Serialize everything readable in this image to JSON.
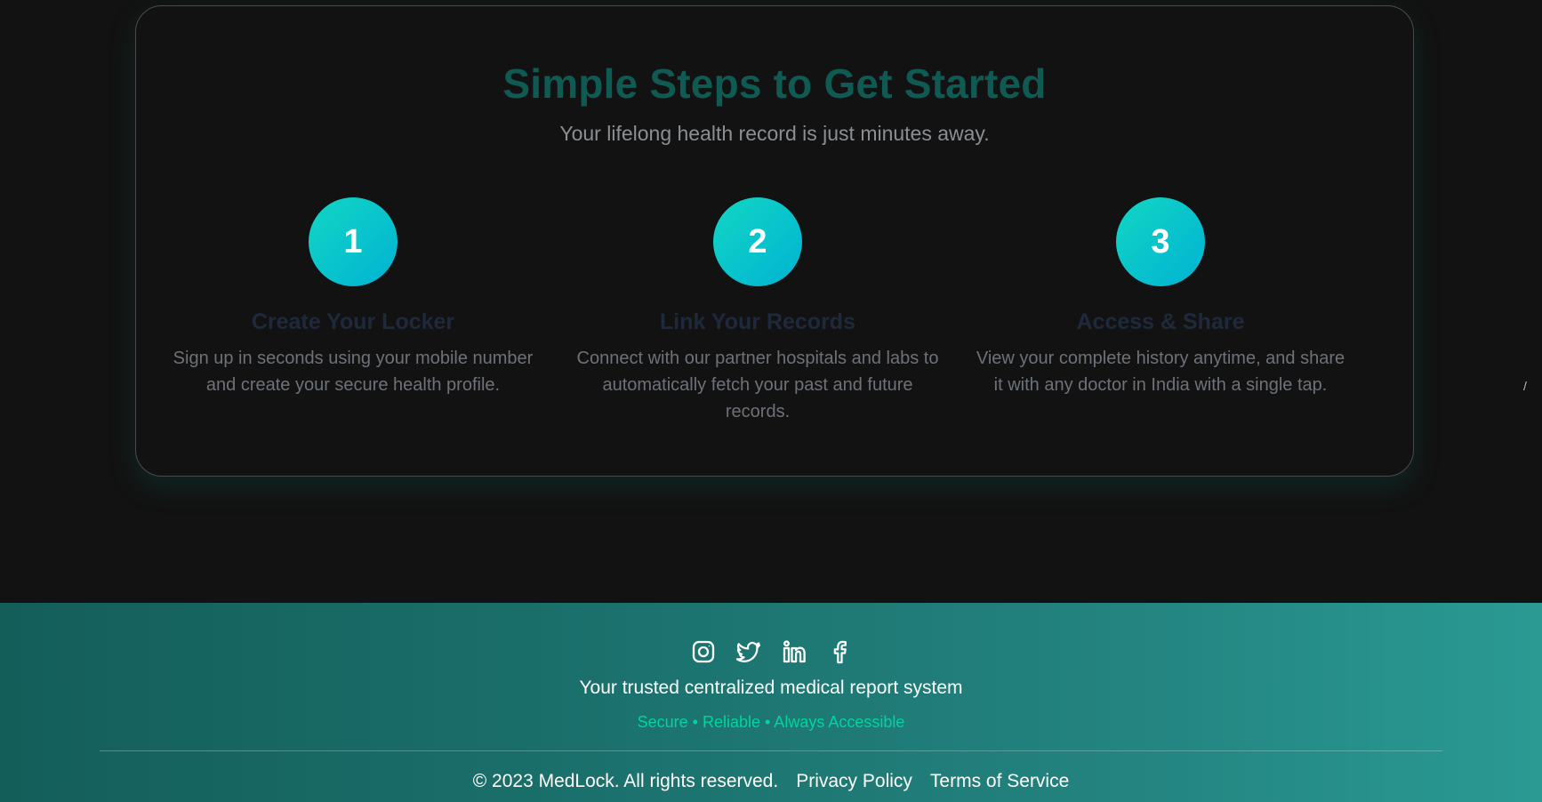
{
  "steps_section": {
    "title": "Simple Steps to Get Started",
    "subtitle": "Your lifelong health record is just minutes away.",
    "steps": [
      {
        "number": "1",
        "title": "Create Your Locker",
        "description": "Sign up in seconds using your mobile number and create your secure health profile."
      },
      {
        "number": "2",
        "title": "Link Your Records",
        "description": "Connect with our partner hospitals and labs to automatically fetch your past and future records."
      },
      {
        "number": "3",
        "title": "Access & Share",
        "description": "View your complete history anytime, and share it with any doctor in India with a single tap."
      }
    ]
  },
  "side_mark": "/",
  "footer": {
    "social_icons": [
      "instagram-icon",
      "twitter-icon",
      "linkedin-icon",
      "facebook-icon"
    ],
    "tagline": "Your trusted centralized medical report system",
    "subtext": "Secure • Reliable • Always Accessible",
    "copyright": "© 2023 MedLock. All rights reserved.",
    "links": [
      "Privacy Policy",
      "Terms of Service"
    ]
  },
  "colors": {
    "page_background": "#121212",
    "title": "#0f5a52",
    "step_circle_start": "#12d6c4",
    "step_circle_end": "#00b3d3",
    "footer_start": "#145e5a",
    "footer_end": "#2a9a93",
    "footer_subtext": "#00d4a0"
  }
}
